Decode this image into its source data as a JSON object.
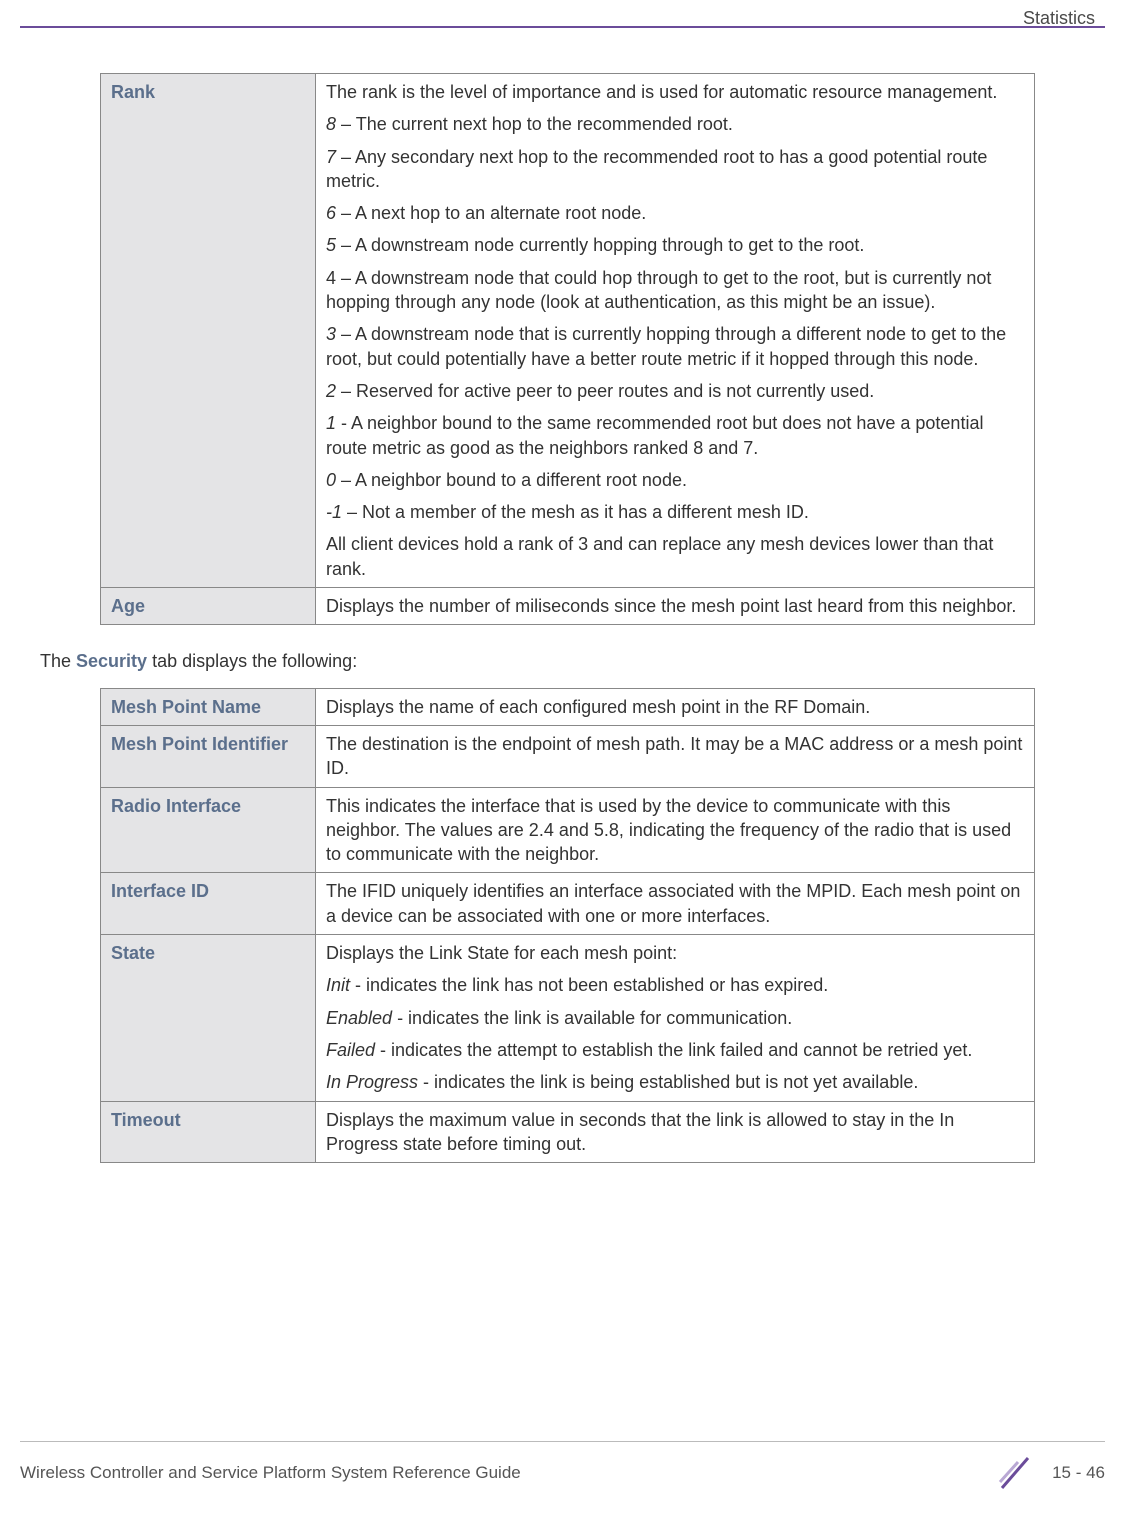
{
  "header": {
    "section": "Statistics"
  },
  "table1": {
    "rows": [
      {
        "label": "Rank",
        "paras": [
          {
            "text": "The rank is the level of importance and is used for automatic resource management."
          },
          {
            "lead": "8",
            "text": " – The current next hop to the recommended root."
          },
          {
            "lead": "7",
            "text": " – Any secondary next hop to the recommended root to has a good potential route metric."
          },
          {
            "lead": "6",
            "text": " – A next hop to an alternate root node."
          },
          {
            "lead": "5",
            "text": " – A downstream node currently hopping through to get to the root."
          },
          {
            "text": "4 – A downstream node that could hop through to get to the root, but is currently not hopping through any node (look at authentication, as this might be an issue)."
          },
          {
            "lead": "3",
            "text": " – A downstream node that is currently hopping through a different node to get to the root, but could potentially have a better route metric if it hopped through this node."
          },
          {
            "lead": "2",
            "text": " – Reserved for active peer to peer routes and is not currently used."
          },
          {
            "lead": "1",
            "text": " - A neighbor bound to the same recommended root but does not have a potential route metric as good as the neighbors ranked 8 and 7."
          },
          {
            "lead": "0",
            "text": " – A neighbor bound to a different root node."
          },
          {
            "lead": "-1",
            "text": " – Not a member of the mesh as it has a different mesh ID."
          },
          {
            "text": "All client devices hold a rank of 3 and can replace any mesh devices lower than that rank."
          }
        ]
      },
      {
        "label": "Age",
        "paras": [
          {
            "text": "Displays the number of miliseconds since the mesh point last heard from this neighbor."
          }
        ]
      }
    ]
  },
  "inter": {
    "pre": "The ",
    "bold": "Security",
    "post": " tab displays the following:"
  },
  "table2": {
    "rows": [
      {
        "label": "Mesh Point Name",
        "paras": [
          {
            "text": "Displays the name of each configured mesh point in the RF Domain."
          }
        ]
      },
      {
        "label": "Mesh Point Identifier",
        "paras": [
          {
            "text": "The destination is the endpoint of mesh path. It may be a MAC address or a mesh point ID."
          }
        ]
      },
      {
        "label": "Radio Interface",
        "paras": [
          {
            "text": "This indicates the interface that is used by the device to communicate with this neighbor. The values are 2.4 and 5.8, indicating the frequency of the radio that is used to communicate with the neighbor."
          }
        ]
      },
      {
        "label": "Interface ID",
        "paras": [
          {
            "text": "The IFID uniquely identifies an interface associated with the MPID. Each mesh point on a device can be associated with one or more interfaces."
          }
        ]
      },
      {
        "label": "State",
        "paras": [
          {
            "text": "Displays the Link State for each mesh point:"
          },
          {
            "lead": "Init",
            "text": " - indicates the link has not been established or has expired."
          },
          {
            "lead": "Enabled",
            "text": " - indicates the link is available for communication."
          },
          {
            "lead": "Failed",
            "text": " - indicates the attempt to establish the link failed and cannot be retried yet."
          },
          {
            "lead": "In Progress",
            "text": " - indicates the link is being established but is not yet available."
          }
        ]
      },
      {
        "label": "Timeout",
        "paras": [
          {
            "text": "Displays the maximum value in seconds that the link is allowed to stay in the In Progress state before timing out."
          }
        ]
      }
    ]
  },
  "footer": {
    "guide": "Wireless Controller and Service Platform System Reference Guide",
    "page": "15 - 46"
  }
}
